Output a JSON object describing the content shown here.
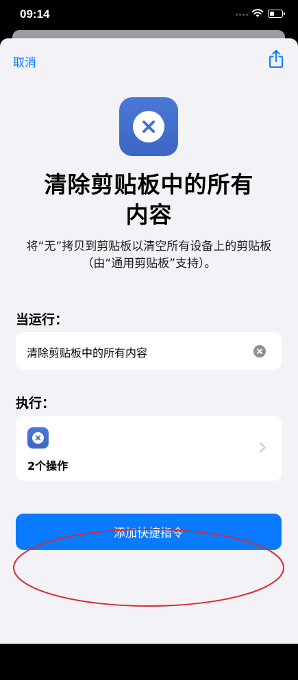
{
  "status_bar": {
    "time": "09:14"
  },
  "nav": {
    "cancel_label": "取消",
    "share_icon": "share-icon"
  },
  "shortcut": {
    "icon": "clear-x-icon",
    "title_line1": "清除剪贴板中的所有",
    "title_line2": "内容",
    "description_line1": "将“无”拷贝到剪贴板以清空所有设备上的剪贴板",
    "description_line2": "（由“通用剪贴板”支持）。"
  },
  "trigger": {
    "label": "当运行：",
    "value": "清除剪贴板中的所有内容"
  },
  "actions": {
    "label": "执行：",
    "count_text": "2个操作"
  },
  "add_button": {
    "label": "添加快捷指令"
  },
  "colors": {
    "accent": "#0a7aff",
    "icon_blue": "#4170cf",
    "sheet_background": "#f2f2f7",
    "annotation_red": "#d9292f"
  }
}
